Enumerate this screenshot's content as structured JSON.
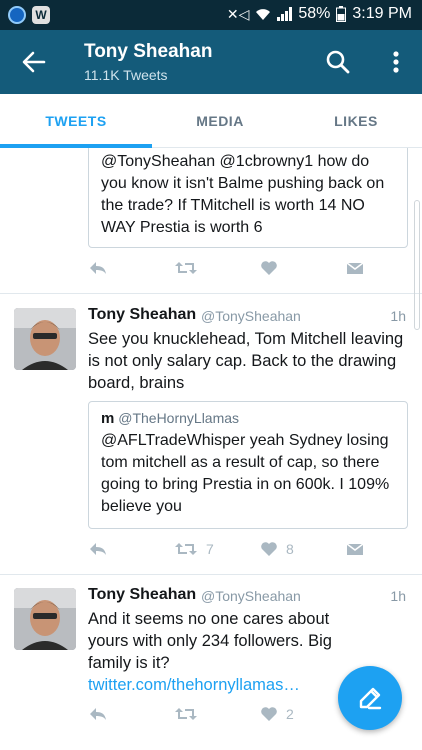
{
  "status_bar": {
    "battery": "58%",
    "time": "3:19 PM",
    "app_badge": "W",
    "colors": {
      "bg": "#0b2a38"
    }
  },
  "header": {
    "title": "Tony Sheahan",
    "subtitle": "11.1K Tweets",
    "colors": {
      "bg": "#145b7a"
    }
  },
  "tabs": [
    {
      "label": "TWEETS",
      "active": true
    },
    {
      "label": "MEDIA",
      "active": false
    },
    {
      "label": "LIKES",
      "active": false
    }
  ],
  "colors": {
    "accent": "#1da1f2",
    "muted": "#aab8c2"
  },
  "feed": {
    "partial_tweet": {
      "quote_text": "@TonySheahan @1cbrowny1 how do you know it isn't Balme pushing back on the trade? If TMitchell is worth 14 NO WAY Prestia is worth 6",
      "retweets": "",
      "likes": ""
    },
    "tweets": [
      {
        "name": "Tony Sheahan",
        "handle": "@TonySheahan",
        "time": "1h",
        "text": "See you knucklehead, Tom Mitchell leaving is not only salary cap. Back to the drawing board, brains",
        "quote": {
          "name": "m",
          "handle": "@TheHornyLlamas",
          "text": "@AFLTradeWhisper yeah Sydney losing tom mitchell as a result of cap, so there going to bring Prestia in on 600k. I 109% believe you"
        },
        "retweets": "7",
        "likes": "8"
      },
      {
        "name": "Tony Sheahan",
        "handle": "@TonySheahan",
        "time": "1h",
        "text": "And it seems no one cares about yours with only 234 followers. Big family is it?",
        "link": "twitter.com/thehornyllamas…",
        "retweets": "",
        "likes": "2"
      }
    ]
  },
  "icons": {
    "back": "arrow-left-icon",
    "search": "search-icon",
    "more": "more-vert-icon",
    "reply": "reply-icon",
    "retweet": "retweet-icon",
    "like": "heart-icon",
    "dm": "envelope-icon",
    "compose": "compose-icon"
  }
}
